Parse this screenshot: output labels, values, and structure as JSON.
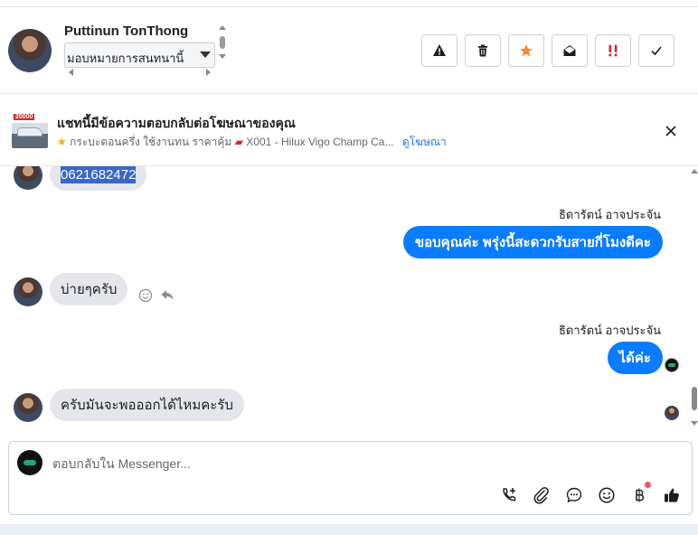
{
  "header": {
    "contact_name": "Puttinun TonThong",
    "assign_value": "มอบหมายการสนทนานี้",
    "actions": [
      {
        "name": "warning-icon"
      },
      {
        "name": "trash-icon"
      },
      {
        "name": "star-icon",
        "color": "#f28c28"
      },
      {
        "name": "envelope-open-icon"
      },
      {
        "name": "follow-up-icon",
        "color": "#d9272e"
      },
      {
        "name": "check-icon"
      }
    ]
  },
  "ad": {
    "thumb_tag": "20000",
    "title": "แชทนี้มีข้อความตอบกลับต่อโฆษณาของคุณ",
    "subtitle": "กระบะตอนครึ่ง ใช้งานทน ราคาคุ้ม",
    "listing": "X001 - Hilux Vigo Champ Ca...",
    "link": "ดูโฆษณา"
  },
  "messages": [
    {
      "from": "customer",
      "text": "0621682472"
    },
    {
      "from": "page",
      "sender": "ธิดารัตน์ อาจประจัน",
      "text": "ขอบคุณค่ะ พรุ่งนี้สะดวกรับสายกี่โมงดีคะ"
    },
    {
      "from": "customer",
      "text": "บ่ายๆครับ"
    },
    {
      "from": "page",
      "sender": "ธิดารัตน์ อาจประจัน",
      "text": "ได้ค่ะ"
    },
    {
      "from": "customer",
      "text": "ครับมันจะพอออกได้ไหมคะรับ"
    }
  ],
  "composer": {
    "placeholder": "ตอบกลับใน Messenger...",
    "tools": [
      "call-plus-icon",
      "paperclip-icon",
      "chat-bubble-icon",
      "smiley-icon",
      "baht-icon",
      "thumbs-up-icon"
    ]
  },
  "colors": {
    "accent": "#0a7cff",
    "incoming_bubble": "#e4e6eb",
    "link": "#1877f2"
  }
}
